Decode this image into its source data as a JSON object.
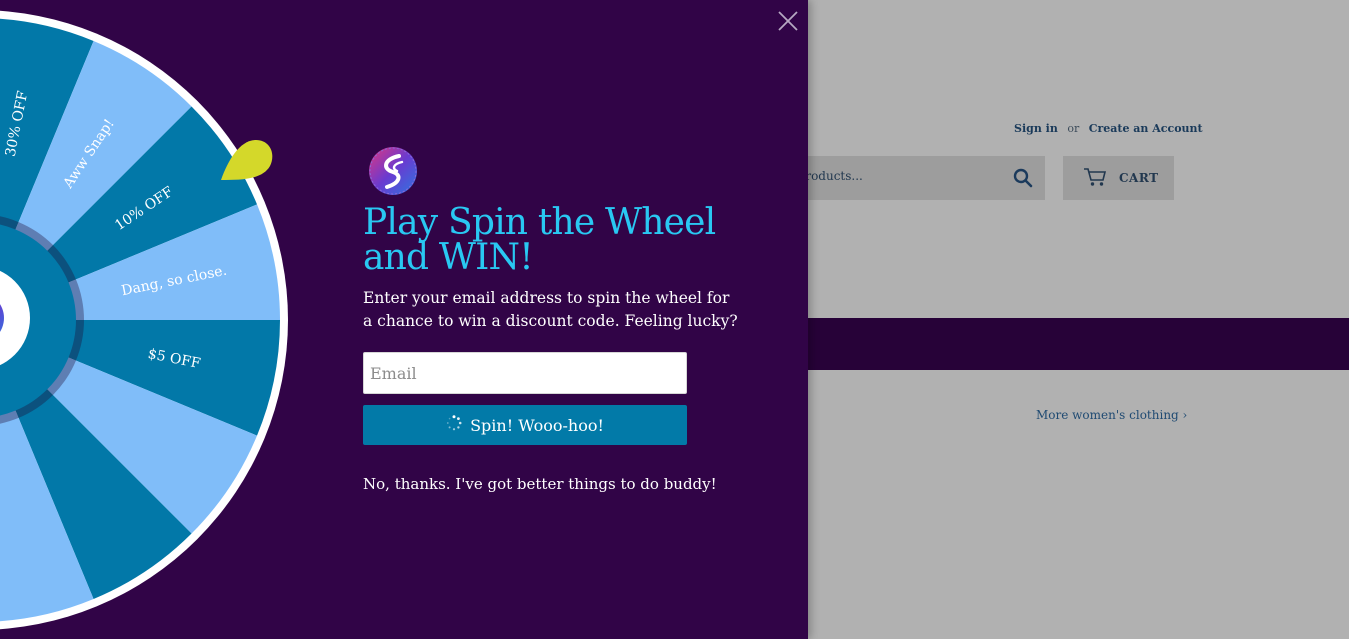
{
  "store": {
    "sign_in": "Sign in",
    "or": "or",
    "create_account": "Create an Account",
    "search_placeholder": "l products...",
    "cart_label": "CART",
    "more_link": "More women's clothing ›"
  },
  "popup": {
    "headline": "Play Spin the Wheel and WIN!",
    "description": "Enter your email address to spin the wheel for a chance to win a discount code. Feeling lucky?",
    "email_placeholder": "Email",
    "spin_label": "Spin! Wooo-hoo!",
    "decline_label": "No, thanks. I've got better things to do buddy!"
  },
  "wheel": {
    "segments": [
      "30% OFF",
      "Aww Snap!",
      "10% OFF",
      "Dang, so close.",
      "$5 OFF"
    ],
    "colors": {
      "dark": "#0278a8",
      "light": "#80bdf9",
      "rim": "#ffffff",
      "pointer": "#d4d82a"
    }
  },
  "colors": {
    "popup_bg": "#310447",
    "headline": "#29c8f2",
    "button": "#027aa8",
    "overlay": "#b1b1b1",
    "nav_band": "#270238"
  },
  "icons": {
    "close": "close-icon",
    "logo": "brand-logo-icon",
    "search": "search-icon",
    "cart": "cart-icon",
    "spinner": "spinner-icon",
    "pointer": "wheel-pointer-icon"
  }
}
